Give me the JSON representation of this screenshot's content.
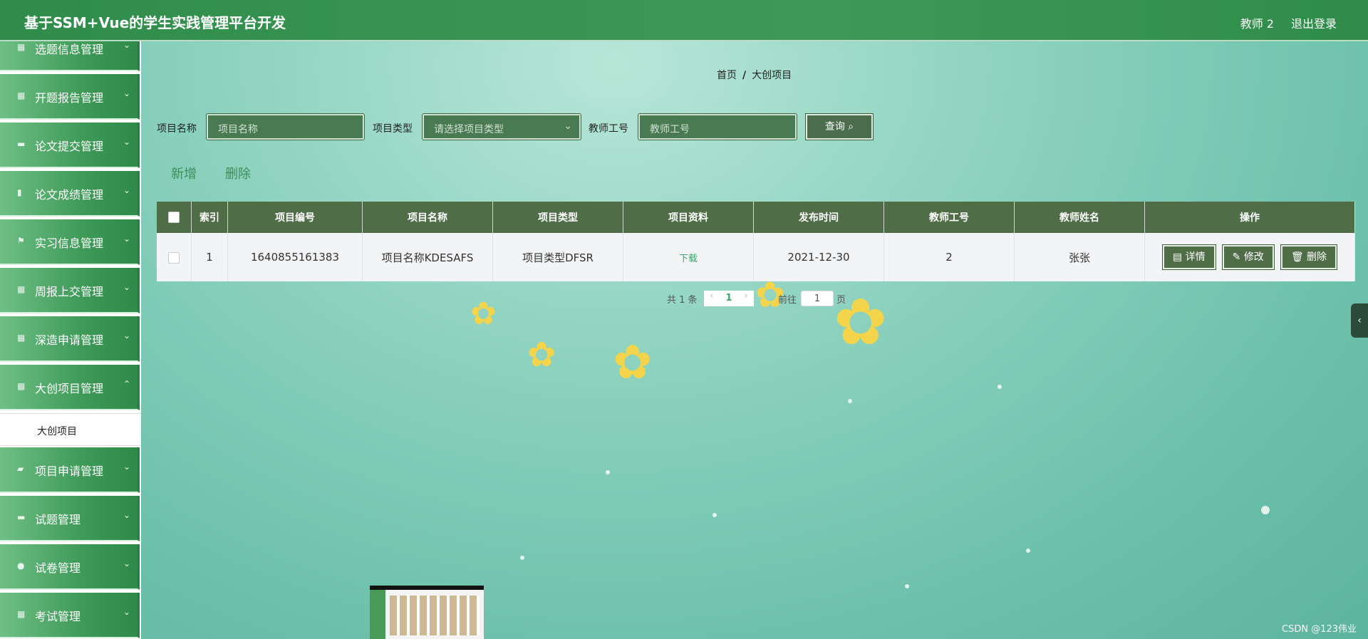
{
  "header": {
    "title": "基于SSM+Vue的学生实践管理平台开发",
    "user": "教师 2",
    "logout": "退出登录"
  },
  "sidebar": {
    "items": [
      {
        "label": "选题信息管理",
        "icon": "grid-icon"
      },
      {
        "label": "开题报告管理",
        "icon": "grid-icon"
      },
      {
        "label": "论文提交管理",
        "icon": "cup-icon"
      },
      {
        "label": "论文成绩管理",
        "icon": "clipboard-icon"
      },
      {
        "label": "实习信息管理",
        "icon": "flag-icon"
      },
      {
        "label": "周报上交管理",
        "icon": "grid-icon"
      },
      {
        "label": "深造申请管理",
        "icon": "grid-icon"
      },
      {
        "label": "大创项目管理",
        "icon": "grid-icon"
      }
    ],
    "submenu_label": "大创项目",
    "items_after": [
      {
        "label": "项目申请管理",
        "icon": "ticket-icon"
      },
      {
        "label": "试题管理",
        "icon": "document-icon"
      },
      {
        "label": "试卷管理",
        "icon": "user-icon"
      },
      {
        "label": "考试管理",
        "icon": "grid-icon"
      }
    ]
  },
  "breadcrumb": {
    "home": "首页",
    "sep": "/",
    "current": "大创项目"
  },
  "search": {
    "name_label": "项目名称",
    "name_placeholder": "项目名称",
    "type_label": "项目类型",
    "type_placeholder": "请选择项目类型",
    "teacher_label": "教师工号",
    "teacher_placeholder": "教师工号",
    "query_button": "查询"
  },
  "actions": {
    "add": "新增",
    "delete": "删除"
  },
  "table": {
    "headers": [
      "索引",
      "项目编号",
      "项目名称",
      "项目类型",
      "项目资料",
      "发布时间",
      "教师工号",
      "教师姓名",
      "操作"
    ],
    "rows": [
      {
        "index": "1",
        "code": "1640855161383",
        "name": "项目名称KDESAFS",
        "type": "项目类型DFSR",
        "file": "下载",
        "date": "2021-12-30",
        "teacher_id": "2",
        "teacher_name": "张张"
      }
    ],
    "ops": {
      "detail": "详情",
      "edit": "修改",
      "delete": "删除"
    }
  },
  "pagination": {
    "total": "共 1 条",
    "page": "1",
    "goto": "前往",
    "goto_value": "1",
    "unit": "页"
  },
  "watermark": "CSDN @123伟业",
  "colors": {
    "header": "#3d9a56",
    "table_header": "#4f6e48",
    "accent_green": "#3f8e5b"
  }
}
